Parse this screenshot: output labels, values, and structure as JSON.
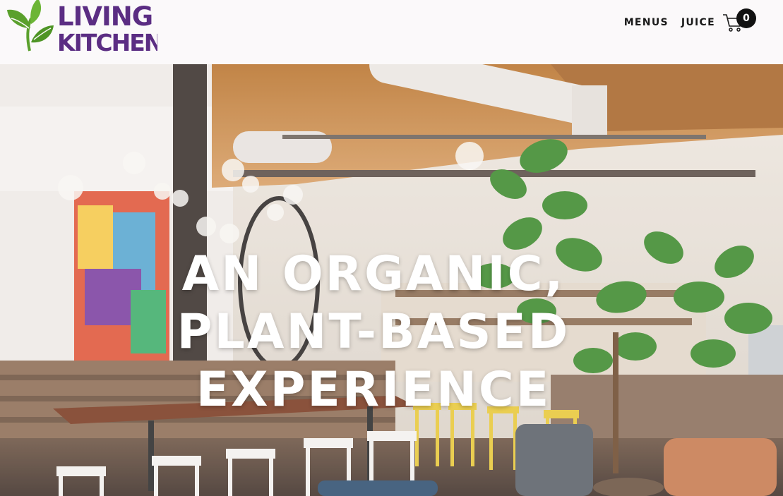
{
  "header": {
    "logo": {
      "line1": "LIVING",
      "line2": "KITCHEN",
      "name": "leaf-logo",
      "color": "#5b2d83",
      "leaf_color": "#5aa02c"
    },
    "nav": [
      {
        "label": "MENUS"
      },
      {
        "label": "JUICE"
      }
    ],
    "cart": {
      "icon": "cart-icon",
      "count": "0"
    }
  },
  "hero": {
    "lines": [
      "AN ORGANIC,",
      "PLANT-BASED",
      "EXPERIENCE"
    ],
    "image": "restaurant-interior-photo"
  }
}
